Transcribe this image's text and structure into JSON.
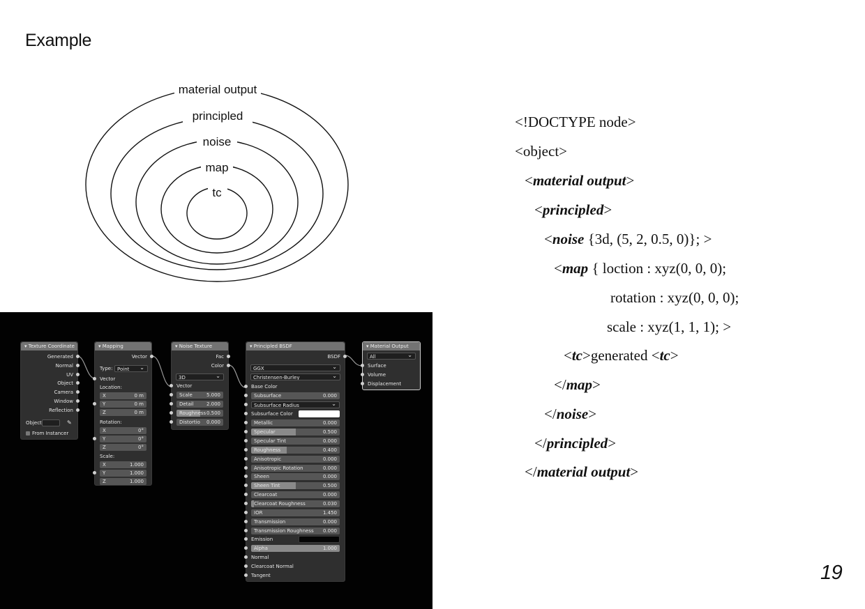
{
  "slide": {
    "title": "Example",
    "page_number": "19"
  },
  "diagram": {
    "labels": [
      "material output",
      "principled",
      "noise",
      "map",
      "tc"
    ]
  },
  "code": {
    "doctype": "<!DOCTYPE node>",
    "object_open": "<object>",
    "material_open": {
      "lt": "<",
      "name": "material output",
      "gt": ">"
    },
    "principled_open": {
      "lt": "<",
      "name": "principled",
      "gt": ">"
    },
    "noise_open": {
      "lt": "<",
      "name": "noise",
      "rest": " {3d, (5, 2, 0.5, 0)}; >"
    },
    "map_open": {
      "lt": "<",
      "name": "map",
      "rest": " { loction : xyz(0, 0, 0);"
    },
    "map_rotation": "rotation : xyz(0, 0, 0);",
    "map_scale": "scale : xyz(1, 1, 1); >",
    "tc_line": {
      "lt1": "<",
      "name1": "tc",
      "mid": ">generated <",
      "name2": "tc",
      "gt": ">"
    },
    "map_close": {
      "lt": "</",
      "name": "map",
      "gt": ">"
    },
    "noise_close": {
      "lt": "</",
      "name": "noise",
      "gt": ">"
    },
    "principled_close": {
      "lt": "</",
      "name": "principled",
      "gt": ">"
    },
    "material_close": {
      "lt": "</",
      "name": "material output",
      "gt": ">"
    }
  },
  "nodes": {
    "texture_coordinate": {
      "title": "▾ Texture Coordinate",
      "outputs": [
        "Generated",
        "Normal",
        "UV",
        "Object",
        "Camera",
        "Window",
        "Reflection"
      ],
      "object_label": "Object",
      "from_instancer": "From Instancer"
    },
    "mapping": {
      "title": "▾ Mapping",
      "output": "Vector",
      "type_label": "Type:",
      "type_value": "Point",
      "vector_input": "Vector",
      "location_label": "Location:",
      "location": [
        {
          "axis": "X",
          "value": "0 m"
        },
        {
          "axis": "Y",
          "value": "0 m"
        },
        {
          "axis": "Z",
          "value": "0 m"
        }
      ],
      "rotation_label": "Rotation:",
      "rotation": [
        {
          "axis": "X",
          "value": "0°"
        },
        {
          "axis": "Y",
          "value": "0°"
        },
        {
          "axis": "Z",
          "value": "0°"
        }
      ],
      "scale_label": "Scale:",
      "scale": [
        {
          "axis": "X",
          "value": "1.000"
        },
        {
          "axis": "Y",
          "value": "1.000"
        },
        {
          "axis": "Z",
          "value": "1.000"
        }
      ]
    },
    "noise_texture": {
      "title": "▾ Noise Texture",
      "outputs": [
        "Fac",
        "Color"
      ],
      "dimension": "3D",
      "vector_input": "Vector",
      "params": [
        {
          "label": "Scale",
          "value": "5.000"
        },
        {
          "label": "Detail",
          "value": "2.000"
        },
        {
          "label": "Roughness",
          "value": "0.500"
        },
        {
          "label": "Distortio",
          "value": "0.000"
        }
      ]
    },
    "principled_bsdf": {
      "title": "▾ Principled BSDF",
      "output": "BSDF",
      "distribution": "GGX",
      "subsurface_method": "Christensen-Burley",
      "base_color": "Base Color",
      "subsurface": {
        "label": "Subsurface",
        "value": "0.000"
      },
      "subsurface_radius": "Subsurface Radius",
      "subsurface_color": "Subsurface Color",
      "params": [
        {
          "label": "Metallic",
          "value": "0.000",
          "fill": 0.0
        },
        {
          "label": "Specular",
          "value": "0.500",
          "fill": 0.5
        },
        {
          "label": "Specular Tint",
          "value": "0.000",
          "fill": 0.0
        },
        {
          "label": "Roughness",
          "value": "0.400",
          "fill": 0.4
        },
        {
          "label": "Anisotropic",
          "value": "0.000",
          "fill": 0.0
        },
        {
          "label": "Anisotropic Rotation",
          "value": "0.000",
          "fill": 0.0
        },
        {
          "label": "Sheen",
          "value": "0.000",
          "fill": 0.0
        },
        {
          "label": "Sheen Tint",
          "value": "0.500",
          "fill": 0.5
        },
        {
          "label": "Clearcoat",
          "value": "0.000",
          "fill": 0.0
        },
        {
          "label": "Clearcoat Roughness",
          "value": "0.030",
          "fill": 0.03
        },
        {
          "label": "IOR",
          "value": "1.450",
          "fill": 0.0
        },
        {
          "label": "Transmission",
          "value": "0.000",
          "fill": 0.0
        },
        {
          "label": "Transmission Roughness",
          "value": "0.000",
          "fill": 0.0
        }
      ],
      "emission": "Emission",
      "alpha": {
        "label": "Alpha",
        "value": "1.000",
        "fill": 1.0
      },
      "tail_inputs": [
        "Normal",
        "Clearcoat Normal",
        "Tangent"
      ]
    },
    "material_output": {
      "title": "▾ Material Output",
      "target": "All",
      "inputs": [
        "Surface",
        "Volume",
        "Displacement"
      ]
    }
  },
  "colors": {
    "editor_bg": "#020202",
    "node_bg": "#2f2f2f",
    "node_header": "#737373",
    "socket": "#cfcfcf"
  }
}
